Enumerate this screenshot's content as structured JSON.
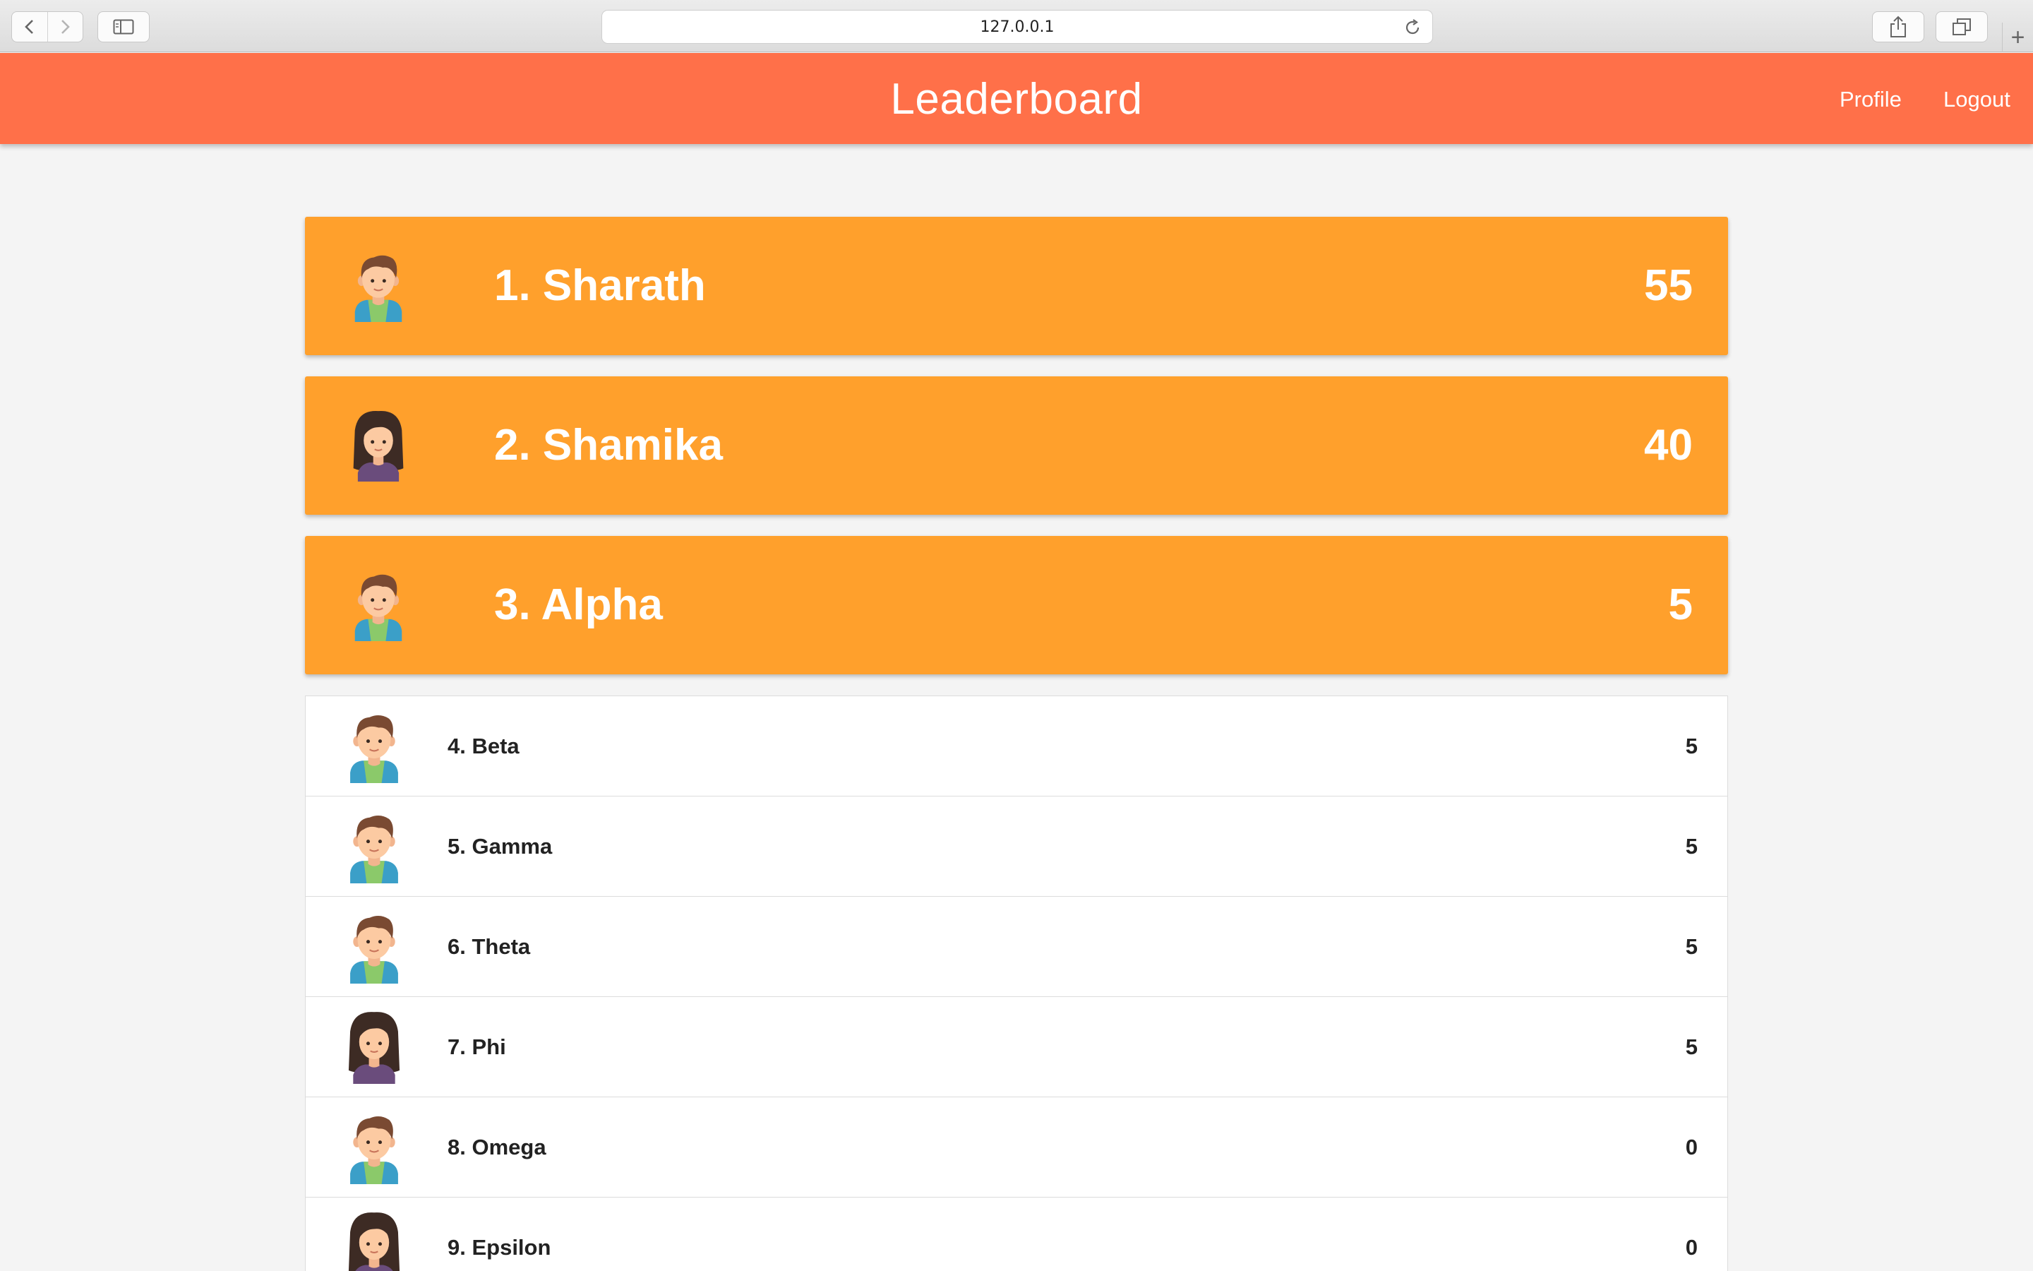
{
  "browser": {
    "url": "127.0.0.1",
    "icons": [
      "back-icon",
      "forward-icon",
      "sidebar-icon",
      "reload-icon",
      "share-icon",
      "tabs-icon",
      "new-tab-icon"
    ]
  },
  "header": {
    "title": "Leaderboard",
    "nav": {
      "profile": "Profile",
      "logout": "Logout"
    },
    "color": "#ff7049"
  },
  "leaderboard": {
    "top": [
      {
        "rank_name": "1. Sharath",
        "score": "55",
        "avatar": "boy"
      },
      {
        "rank_name": "2. Shamika",
        "score": "40",
        "avatar": "girl"
      },
      {
        "rank_name": "3. Alpha",
        "score": "5",
        "avatar": "boy"
      }
    ],
    "rest": [
      {
        "rank_name": "4. Beta",
        "score": "5",
        "avatar": "boy"
      },
      {
        "rank_name": "5. Gamma",
        "score": "5",
        "avatar": "boy"
      },
      {
        "rank_name": "6. Theta",
        "score": "5",
        "avatar": "boy"
      },
      {
        "rank_name": "7. Phi",
        "score": "5",
        "avatar": "girl"
      },
      {
        "rank_name": "8. Omega",
        "score": "0",
        "avatar": "boy"
      },
      {
        "rank_name": "9. Epsilon",
        "score": "0",
        "avatar": "girl"
      }
    ],
    "top_card_color": "#ffa02c"
  }
}
